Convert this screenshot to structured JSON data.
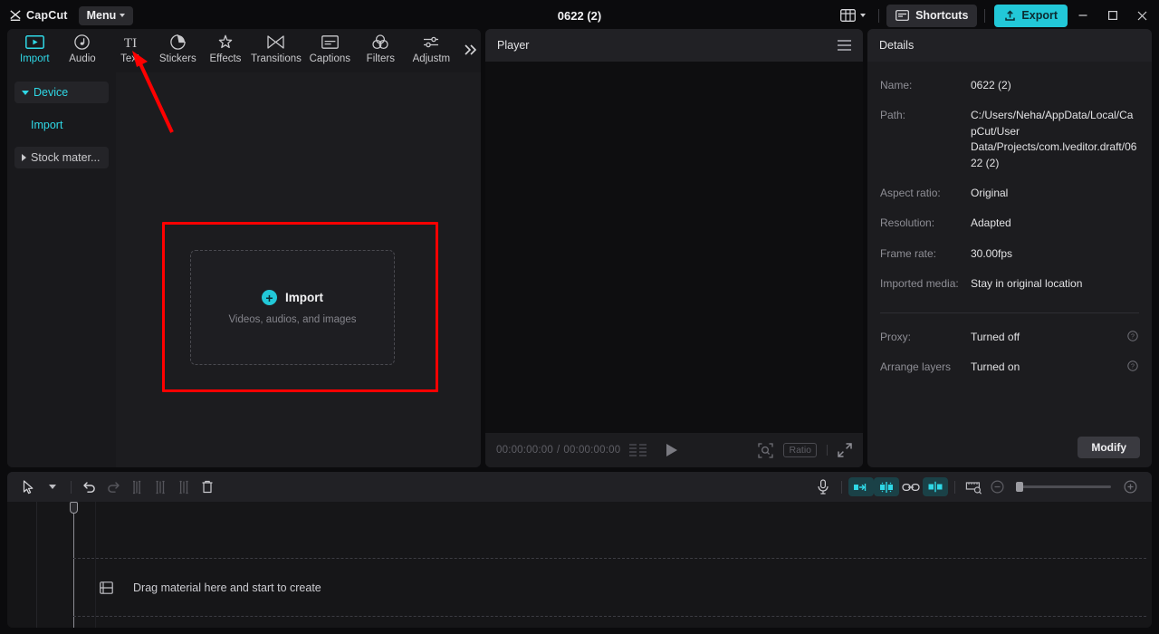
{
  "app": {
    "brand": "CapCut",
    "menu_label": "Menu",
    "project_title": "0622 (2)"
  },
  "titlebar": {
    "layout_icon": "layout-icon",
    "shortcuts_label": "Shortcuts",
    "shortcuts_icon": "keyboard-icon",
    "export_label": "Export",
    "export_icon": "upload-icon",
    "minimize_icon": "minimize-icon",
    "maximize_icon": "maximize-icon",
    "close_icon": "close-icon",
    "accent_color": "#22c8d8"
  },
  "media_panel": {
    "tabs": [
      {
        "label": "Import",
        "icon": "import-icon",
        "active": true
      },
      {
        "label": "Audio",
        "icon": "audio-icon",
        "active": false
      },
      {
        "label": "Text",
        "icon": "text-icon",
        "active": false
      },
      {
        "label": "Stickers",
        "icon": "stickers-icon",
        "active": false
      },
      {
        "label": "Effects",
        "icon": "effects-icon",
        "active": false
      },
      {
        "label": "Transitions",
        "icon": "transitions-icon",
        "active": false
      },
      {
        "label": "Captions",
        "icon": "captions-icon",
        "active": false
      },
      {
        "label": "Filters",
        "icon": "filters-icon",
        "active": false
      },
      {
        "label": "Adjustm",
        "icon": "adjustment-icon",
        "active": false
      }
    ],
    "more_tabs_icon": "chevron-double-right-icon",
    "sidenav": [
      {
        "label": "Device",
        "state": "expanded",
        "selected": true
      },
      {
        "label": "Import",
        "state": "sub",
        "selected": true
      },
      {
        "label": "Stock mater...",
        "state": "collapsed",
        "selected": false
      }
    ],
    "drop_zone": {
      "title": "Import",
      "subtitle": "Videos, audios, and images",
      "plus_icon": "plus-circle-icon"
    },
    "annotation": {
      "highlight_color": "#ff0000",
      "arrow_color": "#ff0000"
    }
  },
  "player": {
    "header_title": "Player",
    "menu_icon": "hamburger-icon",
    "current_time": "00:00:00:00",
    "total_time": "00:00:00:00",
    "time_separator": "/",
    "keyframe_icon": "keyframe-list-icon",
    "play_icon": "play-icon",
    "zoom_fit_icon": "zoom-fit-icon",
    "ratio_label": "Ratio",
    "fullscreen_icon": "fullscreen-icon"
  },
  "details": {
    "header_title": "Details",
    "rows": [
      {
        "label": "Name:",
        "value": "0622 (2)",
        "help": false
      },
      {
        "label": "Path:",
        "value": "C:/Users/Neha/AppData/Local/CapCut/User Data/Projects/com.lveditor.draft/0622 (2)",
        "help": false
      },
      {
        "label": "Aspect ratio:",
        "value": "Original",
        "help": false
      },
      {
        "label": "Resolution:",
        "value": "Adapted",
        "help": false
      },
      {
        "label": "Frame rate:",
        "value": "30.00fps",
        "help": false
      },
      {
        "label": "Imported media:",
        "value": "Stay in original location",
        "help": false
      }
    ],
    "rows2": [
      {
        "label": "Proxy:",
        "value": "Turned off",
        "help": true,
        "help_icon": "help-circle-icon"
      },
      {
        "label": "Arrange layers",
        "value": "Turned on",
        "help": true,
        "help_icon": "help-circle-icon"
      }
    ],
    "modify_label": "Modify"
  },
  "timeline": {
    "tools": [
      {
        "name": "select-tool",
        "icon": "cursor-icon",
        "enabled": true
      },
      {
        "name": "select-dropdown",
        "icon": "chevron-down-icon",
        "enabled": true
      },
      {
        "name": "undo",
        "icon": "undo-icon",
        "enabled": true
      },
      {
        "name": "redo",
        "icon": "redo-icon",
        "enabled": false
      },
      {
        "name": "split",
        "icon": "split-icon",
        "enabled": false
      },
      {
        "name": "trim-left",
        "icon": "trim-left-icon",
        "enabled": false
      },
      {
        "name": "trim-right",
        "icon": "trim-right-icon",
        "enabled": false
      },
      {
        "name": "delete",
        "icon": "trash-icon",
        "enabled": true
      }
    ],
    "right_tools": [
      {
        "name": "record-voiceover",
        "icon": "microphone-icon",
        "active": false
      },
      {
        "name": "auto-cut",
        "icon": "auto-cut-icon",
        "active": true
      },
      {
        "name": "keyframe-snap",
        "icon": "snap-icon",
        "active": true
      },
      {
        "name": "link-clips",
        "icon": "link-icon",
        "active": false
      },
      {
        "name": "mirror-split",
        "icon": "mirror-split-icon",
        "active": true
      },
      {
        "name": "preview-ruler",
        "icon": "preview-ruler-icon",
        "active": false
      }
    ],
    "zoom_out_icon": "zoom-out-icon",
    "zoom_in_icon": "zoom-in-icon",
    "zoom_value": 6,
    "drop_hint": "Drag material here and start to create",
    "drop_hint_icon": "film-strip-icon",
    "playhead_position": "00:00:00:00"
  }
}
